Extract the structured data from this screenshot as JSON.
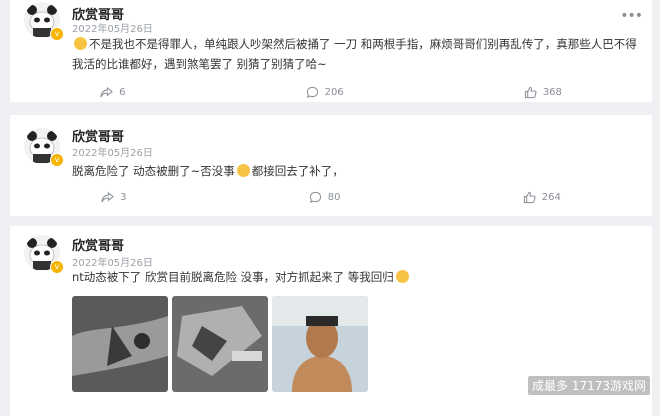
{
  "posts": [
    {
      "author": "欣赏哥哥",
      "date": "2022年05月26日",
      "text": "不是我也不是得罪人，单纯跟人吵架然后被捅了 一刀 和两根手指，麻烦哥哥们别再乱传了，真那些人巴不得我活的比谁都好，遇到煞笔罢了 别猜了别猜了哈~",
      "shares": "6",
      "comments": "206",
      "likes": "368"
    },
    {
      "author": "欣赏哥哥",
      "date": "2022年05月26日",
      "text_a": "脱离危险了 动态被删了~否没事",
      "text_b": "都接回去了补了，",
      "shares": "3",
      "comments": "80",
      "likes": "264"
    },
    {
      "author": "欣赏哥哥",
      "date": "2022年05月26日",
      "text": "nt动态被下了 欣赏目前脱离危险 没事，对方抓起来了 等我回归"
    }
  ],
  "icons": {
    "more": "more-dots-icon",
    "share": "share-icon",
    "comment": "comment-icon",
    "like": "like-icon",
    "verified": "verified-badge-icon"
  },
  "watermark": "成最多 17173游戏网",
  "colors": {
    "background": "#eef0f3",
    "card": "#ffffff",
    "badge": "#f5b400",
    "muted": "#8a8f96"
  }
}
